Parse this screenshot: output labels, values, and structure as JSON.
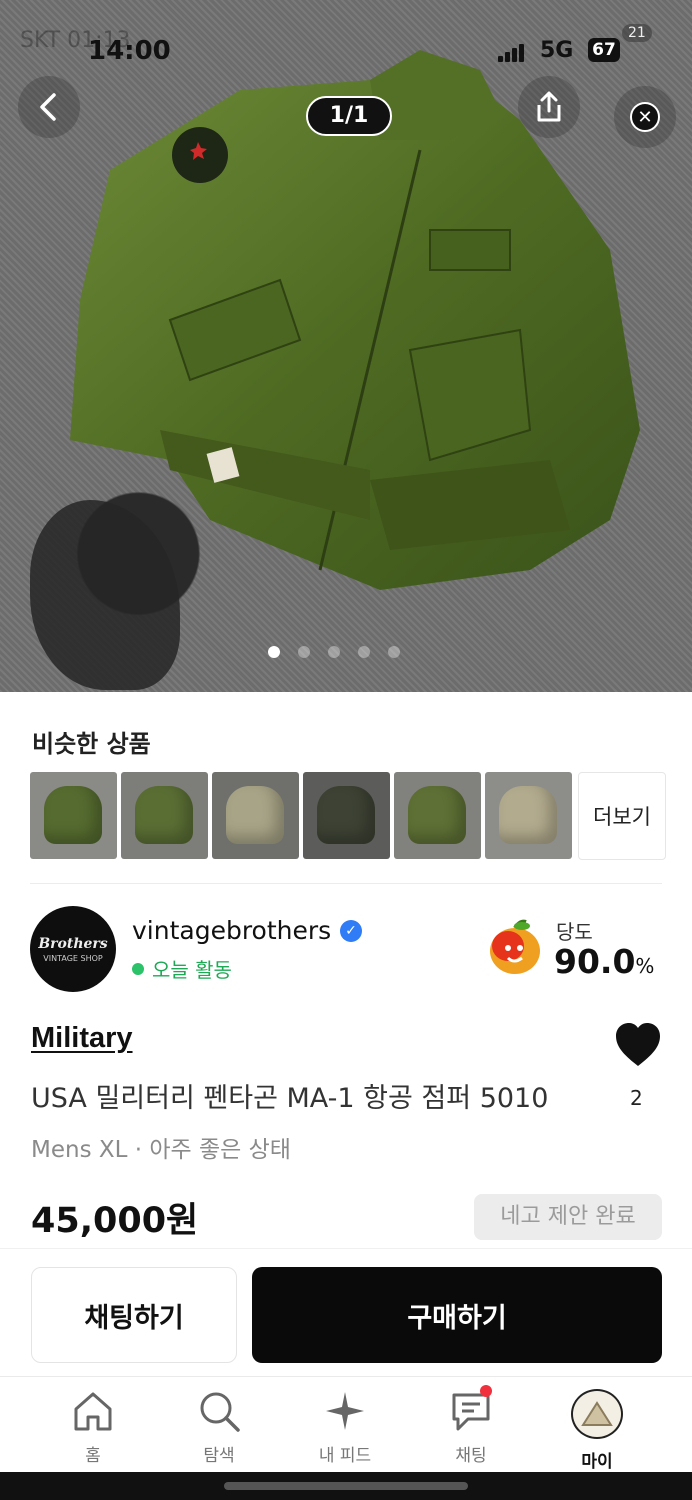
{
  "status_bar": {
    "time": "14:00",
    "network": "5G",
    "battery": "67",
    "notification_count": "21"
  },
  "gallery": {
    "pager": "1/1",
    "dot_count": 5,
    "active_dot": 0
  },
  "similar": {
    "title": "비슷한 상품",
    "more_label": "더보기",
    "thumb_colors": [
      "#556b2f",
      "#5a6e34",
      "#a8a487",
      "#3d4234",
      "#5e7035",
      "#b2ab8e"
    ]
  },
  "seller": {
    "name": "vintagebrothers",
    "avatar_text": "Brothers",
    "avatar_subtext": "VINTAGE SHOP",
    "activity": "오늘 활동",
    "sweetness_label": "당도",
    "sweetness_value": "90.0",
    "sweetness_unit": "%"
  },
  "product": {
    "brand": "Military",
    "title": "USA 밀리터리 펜타곤 MA-1 항공 점퍼 5010",
    "meta": "Mens XL · 아주 좋은 상태",
    "price": "45,000원",
    "likes": "2",
    "negotiation": "네고 제안 완료"
  },
  "actions": {
    "chat": "채팅하기",
    "buy": "구매하기"
  },
  "tabs": [
    {
      "label": "홈",
      "icon": "home-icon"
    },
    {
      "label": "탐색",
      "icon": "search-icon"
    },
    {
      "label": "내 피드",
      "icon": "sparkle-icon"
    },
    {
      "label": "채팅",
      "icon": "chat-icon"
    },
    {
      "label": "마이",
      "icon": "profile-avatar"
    }
  ],
  "colors": {
    "accent_green": "#1fa855",
    "verified_blue": "#2f7cf6",
    "notification_red": "#f0303c",
    "primary_button": "#0a0a0a"
  }
}
